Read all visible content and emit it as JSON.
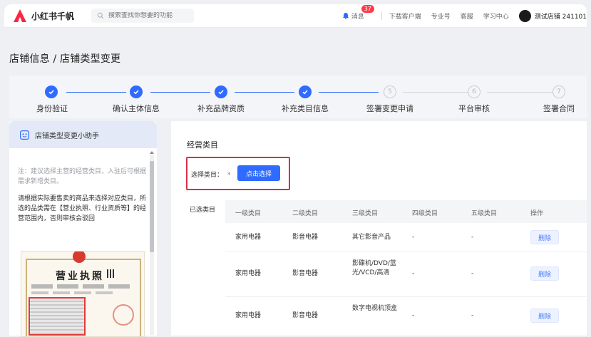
{
  "header": {
    "logo_text": "小红书千帆",
    "search_placeholder": "搜索查找你想要的功能",
    "message_label": "消息",
    "message_count": "37",
    "links": [
      "下载客户端",
      "专业号",
      "客服",
      "学习中心"
    ],
    "store_name": "测试店铺 241101"
  },
  "page_title": "店铺信息 / 店铺类型变更",
  "steps": [
    {
      "label": "身份验证",
      "status": "done"
    },
    {
      "label": "确认主体信息",
      "status": "done"
    },
    {
      "label": "补充品牌资质",
      "status": "done"
    },
    {
      "label": "补充类目信息",
      "status": "done"
    },
    {
      "label": "签署变更申请",
      "status": "todo",
      "number": "5"
    },
    {
      "label": "平台审核",
      "status": "todo",
      "number": "6"
    },
    {
      "label": "签署合同",
      "status": "todo",
      "number": "7"
    }
  ],
  "helper": {
    "title": "店铺类型变更小助手",
    "note": "注：建议选择主营的经营类目，入驻后可根据需求新增类目。",
    "description": "请根据实际要售卖的商品来选择对应类目，所选的品类需在【营业执照、行业资质等】的经营范围内，否则审核会驳回",
    "license_title": "营业执照"
  },
  "main": {
    "section_title": "经营类目",
    "select_label": "选择类目：",
    "required_mark": "*",
    "select_button": "点击选择",
    "chosen_label": "已选类目",
    "columns": [
      "一级类目",
      "二级类目",
      "三级类目",
      "四级类目",
      "五级类目",
      "操作"
    ],
    "rows": [
      {
        "c1": "家用电器",
        "c2": "影音电器",
        "c3": "其它影音产品",
        "c4": "-",
        "c5": "-",
        "action": "删除"
      },
      {
        "c1": "家用电器",
        "c2": "影音电器",
        "c3": "影碟机/DVD/蓝光/VCD/高清",
        "c4": "-",
        "c5": "-",
        "action": "删除"
      },
      {
        "c1": "家用电器",
        "c2": "影音电器",
        "c3": "数字电视机顶盒",
        "c4": "-",
        "c5": "-",
        "action": "删除"
      }
    ]
  },
  "colors": {
    "primary": "#2f6bff",
    "highlight": "#d8314a",
    "badge": "#ff3b4a"
  }
}
